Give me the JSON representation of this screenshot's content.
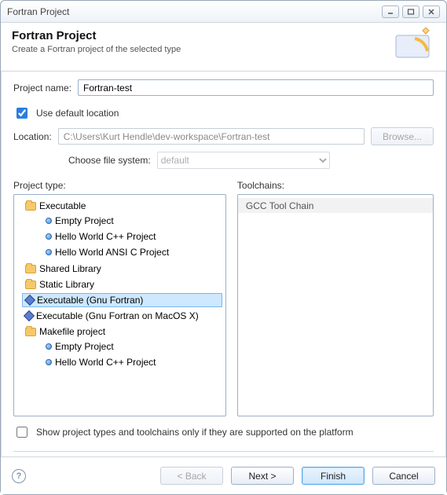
{
  "window": {
    "title": "Fortran Project"
  },
  "banner": {
    "heading": "Fortran Project",
    "subheading": "Create a Fortran project of the selected type"
  },
  "form": {
    "project_name_label": "Project name:",
    "project_name_value": "Fortran-test",
    "use_default_location_label": "Use default location",
    "use_default_location_checked": true,
    "location_label": "Location:",
    "location_value": "C:\\Users\\Kurt Hendle\\dev-workspace\\Fortran-test",
    "browse_label": "Browse...",
    "choose_fs_label": "Choose file system:",
    "choose_fs_value": "default"
  },
  "columns": {
    "project_type_label": "Project type:",
    "toolchains_label": "Toolchains:"
  },
  "tree": {
    "executable": {
      "label": "Executable",
      "children": {
        "empty": "Empty Project",
        "hw_cpp": "Hello World C++ Project",
        "hw_ansic": "Hello World ANSI C Project"
      }
    },
    "shared_library": {
      "label": "Shared Library"
    },
    "static_library": {
      "label": "Static Library"
    },
    "exec_gnu_fortran": {
      "label": "Executable (Gnu Fortran)"
    },
    "exec_gnu_fortran_mac": {
      "label": "Executable (Gnu Fortran on MacOS X)"
    },
    "makefile": {
      "label": "Makefile project",
      "children": {
        "empty": "Empty Project",
        "hw_cpp": "Hello World C++ Project"
      }
    }
  },
  "toolchains": {
    "items": {
      "gcc": "GCC Tool Chain"
    }
  },
  "show_supported_label": "Show project types and toolchains only if they are supported on the platform",
  "buttons": {
    "back": "< Back",
    "next": "Next >",
    "finish": "Finish",
    "cancel": "Cancel"
  }
}
